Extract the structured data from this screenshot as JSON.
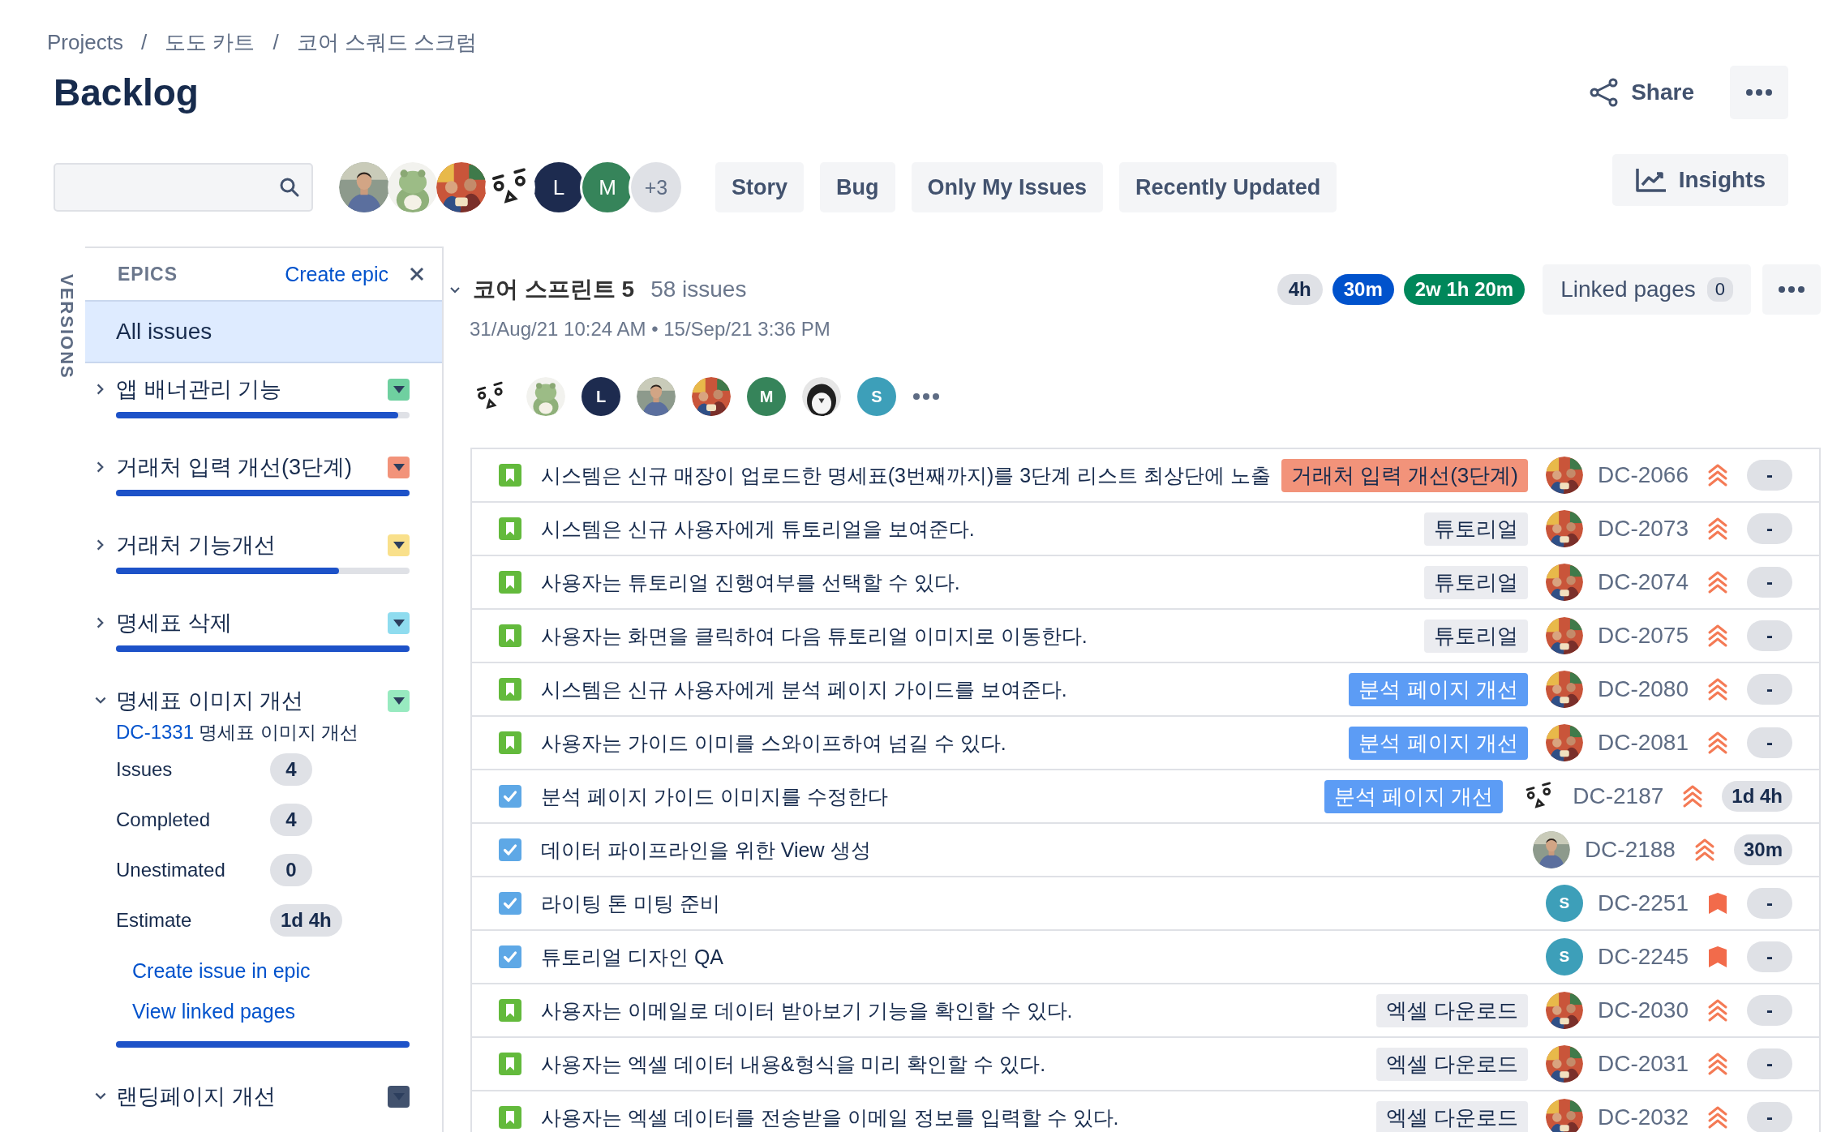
{
  "breadcrumb": [
    "Projects",
    "/",
    "도도 카트",
    "/",
    "코어 스쿼드 스크럼"
  ],
  "title": "Backlog",
  "share": "Share",
  "toolbar": {
    "avatars": [
      {
        "kind": "picture"
      },
      {
        "kind": "picture"
      },
      {
        "kind": "picture"
      },
      {
        "kind": "picture"
      },
      {
        "kind": "initial",
        "text": "L",
        "color": "#1d2b4f"
      },
      {
        "kind": "initial",
        "text": "M",
        "color": "#36845a"
      },
      {
        "kind": "more",
        "text": "+3"
      }
    ],
    "filters": [
      {
        "label": "Story",
        "selected": false
      },
      {
        "label": "Bug",
        "selected": false
      },
      {
        "label": "Only My Issues",
        "selected": false
      },
      {
        "label": "Recently Updated",
        "selected": false
      }
    ],
    "insights": "Insights"
  },
  "versions_label": "VERSIONS",
  "epics": {
    "heading": "EPICS",
    "create": "Create epic",
    "all_issues": {
      "label": "All issues",
      "selected": true
    },
    "items": [
      {
        "name": "앱 배너관리 기능",
        "color": "#6fd0a0",
        "level": 0.96,
        "expanded": false,
        "selected": false
      },
      {
        "name": "거래처 입력 개선(3단계)",
        "color": "#f2937a",
        "level": 1,
        "expanded": false,
        "selected": false
      },
      {
        "name": "거래처 기능개선",
        "color": "#f9e08b",
        "level": 0.76,
        "expanded": false,
        "selected": false
      },
      {
        "name": "명세표 삭제",
        "color": "#8fdcef",
        "level": 1,
        "expanded": false,
        "selected": false
      },
      {
        "name": "명세표 이미지 개선",
        "color": "#98eac0",
        "level": 1,
        "expanded": true,
        "selected": false,
        "details": {
          "key": "DC-1331",
          "summary": "명세표 이미지 개선",
          "stats": [
            {
              "label": "Issues",
              "value": "4"
            },
            {
              "label": "Completed",
              "value": "4"
            },
            {
              "label": "Unestimated",
              "value": "0"
            },
            {
              "label": "Estimate",
              "value": "1d 4h"
            }
          ],
          "links": [
            "Create issue in epic",
            "View linked pages"
          ]
        }
      },
      {
        "name": "랜딩페이지 개선",
        "color": "#42526e",
        "expanded": true,
        "selected": false
      }
    ]
  },
  "sprint": {
    "name": "코어 스프린트 5",
    "expanded": true,
    "count": "58 issues",
    "dates": "31/Aug/21 10:24 AM • 15/Sep/21 3:36 PM",
    "estimates": [
      {
        "text": "4h",
        "color": "#dfe1e6"
      },
      {
        "text": "30m",
        "color": "#0052cc"
      },
      {
        "text": "2w 1h 20m",
        "color": "#00875a"
      }
    ],
    "linked_pages": {
      "label": "Linked pages",
      "count": "0"
    },
    "avatars": [
      {
        "kind": "picture"
      },
      {
        "kind": "picture"
      },
      {
        "kind": "initial",
        "text": "L",
        "color": "#1d2b4f"
      },
      {
        "kind": "picture"
      },
      {
        "kind": "picture"
      },
      {
        "kind": "initial",
        "text": "M",
        "color": "#36845a"
      },
      {
        "kind": "picture"
      },
      {
        "kind": "initial",
        "text": "S",
        "color": "#3d9fb9"
      }
    ],
    "issues": [
      {
        "kind": "story",
        "summary": "시스템은 신규 매장이 업로드한 명세표(3번째까지)를 3단계 리스트 최상단에 노출",
        "epic": {
          "text": "거래처 입력 개선(3단계)",
          "color": "#f2937a"
        },
        "assignee": {
          "kind": "picture"
        },
        "key": "DC-2066",
        "priority": {
          "kind": "highest"
        },
        "estimate": "-"
      },
      {
        "kind": "story",
        "summary": "시스템은 신규 사용자에게 튜토리얼을 보여준다.",
        "epic": {
          "text": "튜토리얼",
          "color": "#ebecf0"
        },
        "assignee": {
          "kind": "picture"
        },
        "key": "DC-2073",
        "priority": {
          "kind": "highest"
        },
        "estimate": "-"
      },
      {
        "kind": "story",
        "summary": "사용자는 튜토리얼 진행여부를 선택할 수 있다.",
        "epic": {
          "text": "튜토리얼",
          "color": "#ebecf0"
        },
        "assignee": {
          "kind": "picture"
        },
        "key": "DC-2074",
        "priority": {
          "kind": "highest"
        },
        "estimate": "-"
      },
      {
        "kind": "story",
        "summary": "사용자는 화면을 클릭하여 다음 튜토리얼 이미지로 이동한다.",
        "epic": {
          "text": "튜토리얼",
          "color": "#ebecf0"
        },
        "assignee": {
          "kind": "picture"
        },
        "key": "DC-2075",
        "priority": {
          "kind": "highest"
        },
        "estimate": "-"
      },
      {
        "kind": "story",
        "summary": "시스템은 신규 사용자에게 분석 페이지 가이드를 보여준다.",
        "epic": {
          "text": "분석 페이지 개선",
          "color": "#5c9cf5"
        },
        "assignee": {
          "kind": "picture"
        },
        "key": "DC-2080",
        "priority": {
          "kind": "highest"
        },
        "estimate": "-"
      },
      {
        "kind": "story",
        "summary": "사용자는 가이드 이미를 스와이프하여 넘길 수 있다.",
        "epic": {
          "text": "분석 페이지 개선",
          "color": "#5c9cf5"
        },
        "assignee": {
          "kind": "picture"
        },
        "key": "DC-2081",
        "priority": {
          "kind": "highest"
        },
        "estimate": "-"
      },
      {
        "kind": "task",
        "summary": "분석 페이지 가이드 이미지를 수정한다",
        "epic": {
          "text": "분석 페이지 개선",
          "color": "#5c9cf5"
        },
        "assignee": {
          "kind": "picture"
        },
        "key": "DC-2187",
        "priority": {
          "kind": "highest"
        },
        "estimate": "1d 4h"
      },
      {
        "kind": "task",
        "summary": "데이터 파이프라인을 위한 View 생성",
        "assignee": {
          "kind": "picture"
        },
        "key": "DC-2188",
        "priority": {
          "kind": "highest"
        },
        "estimate": "30m"
      },
      {
        "kind": "task",
        "summary": "라이팅 톤 미팅 준비",
        "assignee": {
          "kind": "initial",
          "text": "S",
          "color": "#3d9fb9"
        },
        "key": "DC-2251",
        "priority": {
          "kind": "critical"
        },
        "estimate": "-"
      },
      {
        "kind": "task",
        "summary": "튜토리얼 디자인 QA",
        "assignee": {
          "kind": "initial",
          "text": "S",
          "color": "#3d9fb9"
        },
        "key": "DC-2245",
        "priority": {
          "kind": "critical"
        },
        "estimate": "-"
      },
      {
        "kind": "story",
        "summary": "사용자는 이메일로 데이터 받아보기 기능을 확인할 수 있다.",
        "epic": {
          "text": "엑셀 다운로드",
          "color": "#ebecf0"
        },
        "assignee": {
          "kind": "picture"
        },
        "key": "DC-2030",
        "priority": {
          "kind": "highest"
        },
        "estimate": "-"
      },
      {
        "kind": "story",
        "summary": "사용자는 엑셀 데이터 내용&형식을 미리 확인할 수 있다.",
        "epic": {
          "text": "엑셀 다운로드",
          "color": "#ebecf0"
        },
        "assignee": {
          "kind": "picture"
        },
        "key": "DC-2031",
        "priority": {
          "kind": "highest"
        },
        "estimate": "-"
      },
      {
        "kind": "story",
        "summary": "사용자는 엑셀 데이터를 전송받을 이메일 정보를 입력할 수 있다.",
        "epic": {
          "text": "엑셀 다운로드",
          "color": "#ebecf0"
        },
        "assignee": {
          "kind": "picture"
        },
        "key": "DC-2032",
        "priority": {
          "kind": "highest"
        },
        "estimate": "-"
      }
    ]
  }
}
